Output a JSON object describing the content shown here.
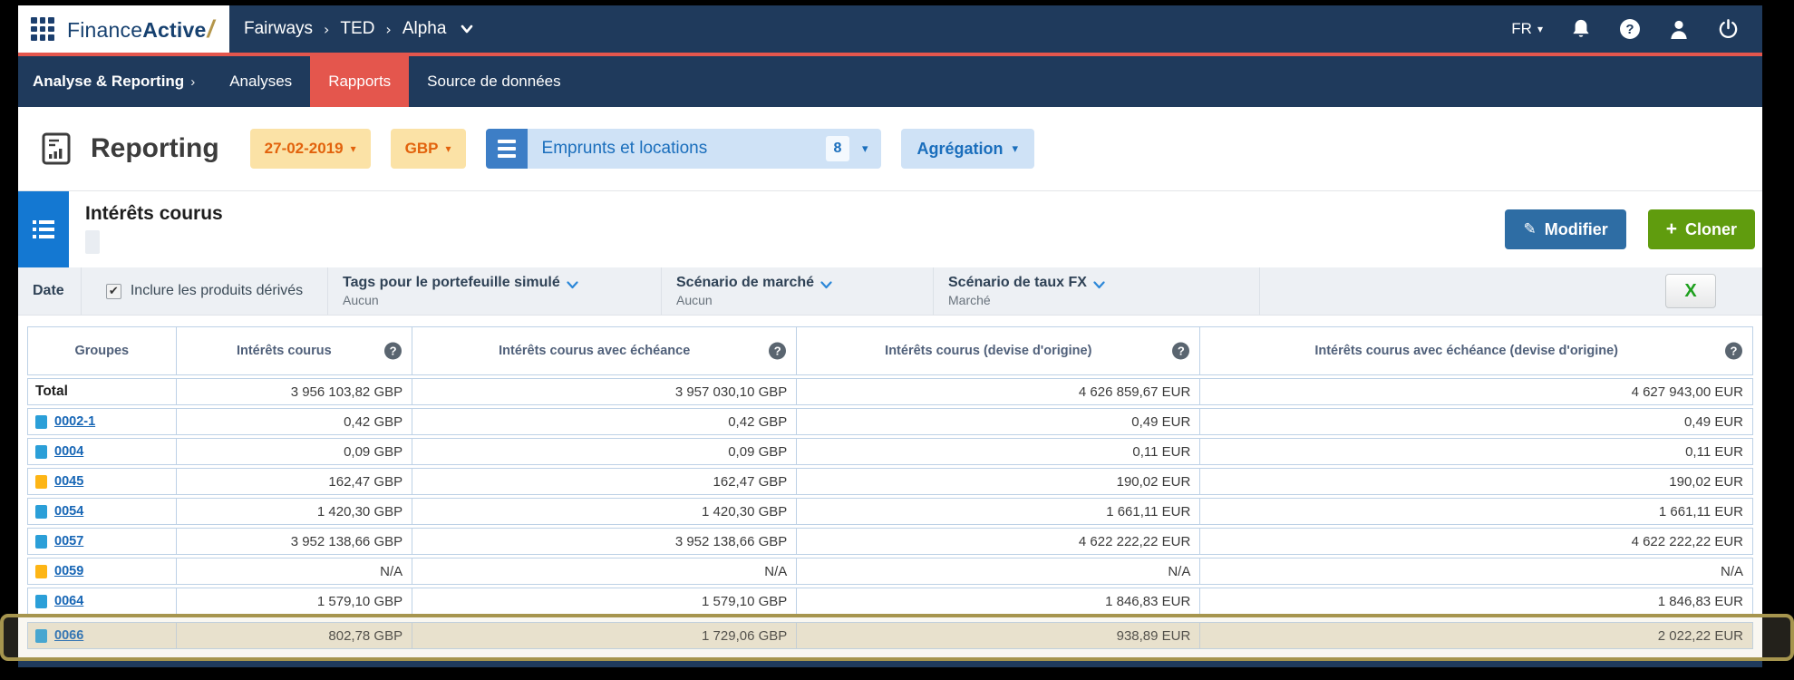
{
  "header": {
    "logo_part1": "Finance",
    "logo_part2": "Active",
    "logo_slash": "/",
    "breadcrumb": [
      "Fairways",
      "TED",
      "Alpha"
    ],
    "breadcrumb_separator": "›",
    "lang": "FR"
  },
  "nav": {
    "section_label": "Analyse & Reporting",
    "section_chevron": "›",
    "items": [
      {
        "label": "Analyses",
        "active": false
      },
      {
        "label": "Rapports",
        "active": true
      },
      {
        "label": "Source de données",
        "active": false
      }
    ]
  },
  "toolbar": {
    "title": "Reporting",
    "date_value": "27-02-2019",
    "currency_value": "GBP",
    "portfolio_value": "Emprunts et locations",
    "portfolio_count": "8",
    "aggregation_label": "Agrégation"
  },
  "report": {
    "title": "Intérêts courus",
    "modify_label": "Modifier",
    "clone_label": "Cloner"
  },
  "filters": {
    "date_label": "Date",
    "derivatives_label": "Inclure les produits dérivés",
    "derivatives_checked": true,
    "tags_label": "Tags pour le portefeuille simulé",
    "tags_value": "Aucun",
    "market_label": "Scénario de marché",
    "market_value": "Aucun",
    "fx_label": "Scénario de taux FX",
    "fx_value": "Marché",
    "excel_label": "X"
  },
  "icons": {
    "caret_down": "▾",
    "check_mark": "✔",
    "pencil": "✎",
    "plus": "+",
    "question_mark": "?"
  },
  "table": {
    "columns": [
      "Groupes",
      "Intérêts courus",
      "Intérêts courus avec échéance",
      "Intérêts courus (devise d'origine)",
      "Intérêts courus avec échéance (devise d'origine)"
    ],
    "total_row": {
      "label": "Total",
      "values": [
        "3 956 103,82 GBP",
        "3 957 030,10 GBP",
        "4 626 859,67 EUR",
        "4 627 943,00 EUR"
      ]
    },
    "rows": [
      {
        "group": "0002-1",
        "marker_color": "#2b9fd8",
        "values": [
          "0,42 GBP",
          "0,42 GBP",
          "0,49 EUR",
          "0,49 EUR"
        ],
        "highlight": false
      },
      {
        "group": "0004",
        "marker_color": "#2b9fd8",
        "values": [
          "0,09 GBP",
          "0,09 GBP",
          "0,11 EUR",
          "0,11 EUR"
        ],
        "highlight": false
      },
      {
        "group": "0045",
        "marker_color": "#fdb515",
        "values": [
          "162,47 GBP",
          "162,47 GBP",
          "190,02 EUR",
          "190,02 EUR"
        ],
        "highlight": false
      },
      {
        "group": "0054",
        "marker_color": "#2b9fd8",
        "values": [
          "1 420,30 GBP",
          "1 420,30 GBP",
          "1 661,11 EUR",
          "1 661,11 EUR"
        ],
        "highlight": false
      },
      {
        "group": "0057",
        "marker_color": "#2b9fd8",
        "values": [
          "3 952 138,66 GBP",
          "3 952 138,66 GBP",
          "4 622 222,22 EUR",
          "4 622 222,22 EUR"
        ],
        "highlight": false
      },
      {
        "group": "0059",
        "marker_color": "#fdb515",
        "values": [
          "N/A",
          "N/A",
          "N/A",
          "N/A"
        ],
        "highlight": false
      },
      {
        "group": "0064",
        "marker_color": "#2b9fd8",
        "values": [
          "1 579,10 GBP",
          "1 579,10 GBP",
          "1 846,83 EUR",
          "1 846,83 EUR"
        ],
        "highlight": false
      },
      {
        "group": "0066",
        "marker_color": "#2b9fd8",
        "values": [
          "802,78 GBP",
          "1 729,06 GBP",
          "938,89 EUR",
          "2 022,22 EUR"
        ],
        "highlight": true
      }
    ]
  },
  "colors": {
    "navy": "#1f3a5c",
    "red_accent": "#e4564d",
    "amber_bg": "#fbe2a6",
    "amber_text": "#e2620c",
    "blue_button": "#3d7ec6",
    "light_blue": "#cfe2f6",
    "blue_text": "#1a6ebc",
    "section_blue": "#1478d2",
    "modify_blue": "#2e6da4",
    "clone_green": "#609c0e",
    "table_border": "#bdd1e6",
    "highlight_border": "#a6954e",
    "highlight_bg": "#ebe5d5",
    "marker_blue": "#2b9fd8",
    "marker_yellow": "#fdb515"
  }
}
